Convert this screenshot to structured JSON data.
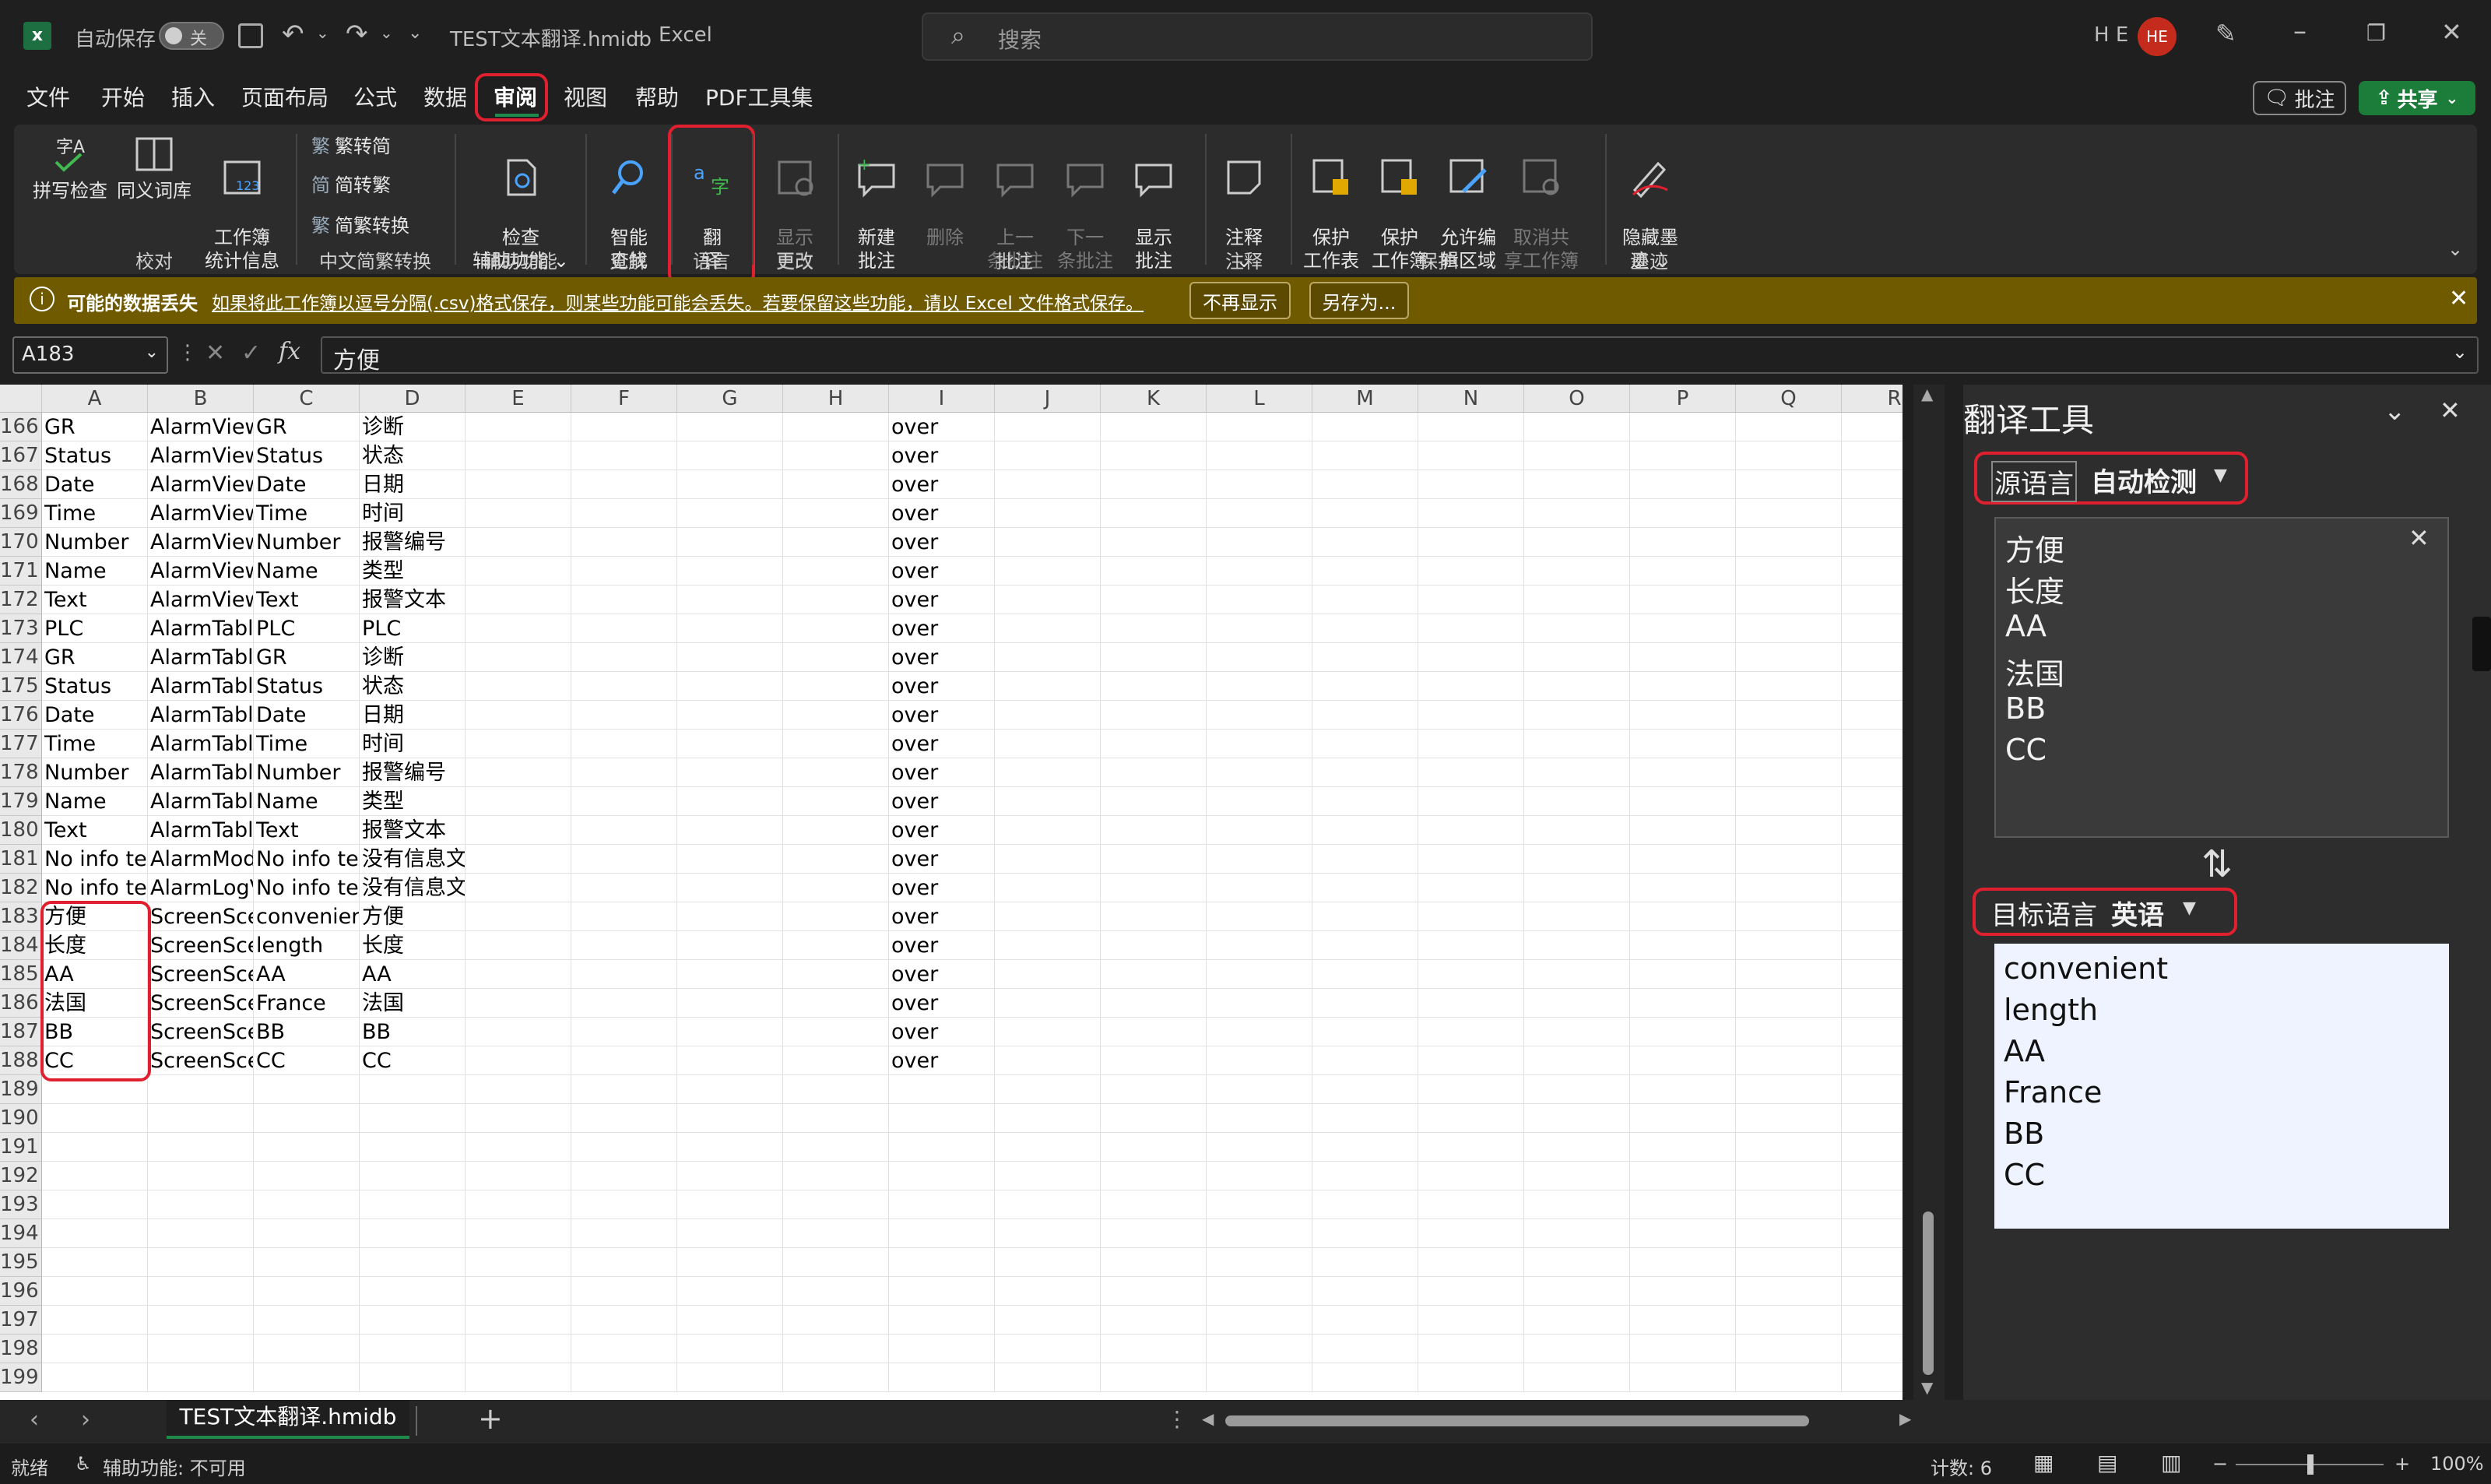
{
  "window": {
    "autosave_label": "自动保存",
    "autosave_state": "关",
    "file_title": "TEST文本翻译.hmidb",
    "app_separator": "-",
    "app_name": "Excel",
    "search_placeholder": "搜索",
    "user_initials": "H E",
    "avatar_text": "HE"
  },
  "menu": {
    "tabs": [
      "文件",
      "开始",
      "插入",
      "页面布局",
      "公式",
      "数据",
      "审阅",
      "视图",
      "帮助",
      "PDF工具集"
    ],
    "active_tab": "审阅",
    "comment_button": "批注",
    "share_button": "共享"
  },
  "ribbon": {
    "groups": {
      "proofing": {
        "label": "校对",
        "items": [
          "拼写检查",
          "同义词库",
          "工作簿\n统计信息"
        ]
      },
      "chinese": {
        "label": "中文简繁转换",
        "items": [
          "繁转简",
          "简转繁",
          "简繁转换"
        ]
      },
      "accessibility": {
        "label": "辅助功能",
        "items": [
          "检查\n辅助功能 ⌄"
        ]
      },
      "insights": {
        "label": "见解",
        "items": [
          "智能\n查找"
        ]
      },
      "language": {
        "label": "语言",
        "items": [
          "翻\n译"
        ]
      },
      "changes": {
        "label": "更改",
        "items": [
          "显示\n更改"
        ]
      },
      "comments": {
        "label": "批注",
        "items": [
          "新建\n批注",
          "删除",
          "上一\n条批注",
          "下一\n条批注",
          "显示\n批注"
        ]
      },
      "notes": {
        "label": "注释",
        "items": [
          "注释\n⌄"
        ]
      },
      "protect": {
        "label": "保护",
        "items": [
          "保护\n工作表",
          "保护\n工作簿",
          "允许编\n辑区域",
          "取消共\n享工作簿"
        ]
      },
      "ink": {
        "label": "墨迹",
        "items": [
          "隐藏墨\n迹 ⌄"
        ]
      }
    }
  },
  "notice": {
    "title": "可能的数据丢失",
    "message": "如果将此工作簿以逗号分隔(.csv)格式保存，则某些功能可能会丢失。若要保留这些功能，请以 Excel 文件格式保存。",
    "dont_show": "不再显示",
    "save_as": "另存为..."
  },
  "formula_bar": {
    "name_box": "A183",
    "fx": "fx",
    "value": "方便"
  },
  "columns": [
    "A",
    "B",
    "C",
    "D",
    "E",
    "F",
    "G",
    "H",
    "I",
    "J",
    "K",
    "L",
    "M",
    "N",
    "O",
    "P",
    "Q",
    "R"
  ],
  "rows": [
    {
      "n": "166",
      "a": "GR",
      "b": "AlarmView",
      "c": "GR",
      "d": "诊断",
      "i": "over"
    },
    {
      "n": "167",
      "a": "Status",
      "b": "AlarmView",
      "c": "Status",
      "d": "状态",
      "i": "over"
    },
    {
      "n": "168",
      "a": "Date",
      "b": "AlarmView",
      "c": "Date",
      "d": "日期",
      "i": "over"
    },
    {
      "n": "169",
      "a": "Time",
      "b": "AlarmView",
      "c": "Time",
      "d": "时间",
      "i": "over"
    },
    {
      "n": "170",
      "a": "Number",
      "b": "AlarmView",
      "c": "Number",
      "d": "报警编号",
      "i": "over"
    },
    {
      "n": "171",
      "a": "Name",
      "b": "AlarmView",
      "c": "Name",
      "d": "类型",
      "i": "over"
    },
    {
      "n": "172",
      "a": "Text",
      "b": "AlarmView",
      "c": "Text",
      "d": "报警文本",
      "i": "over"
    },
    {
      "n": "173",
      "a": "PLC",
      "b": "AlarmTabl",
      "c": "PLC",
      "d": "PLC",
      "i": "over"
    },
    {
      "n": "174",
      "a": "GR",
      "b": "AlarmTabl",
      "c": "GR",
      "d": "诊断",
      "i": "over"
    },
    {
      "n": "175",
      "a": "Status",
      "b": "AlarmTabl",
      "c": "Status",
      "d": "状态",
      "i": "over"
    },
    {
      "n": "176",
      "a": "Date",
      "b": "AlarmTabl",
      "c": "Date",
      "d": "日期",
      "i": "over"
    },
    {
      "n": "177",
      "a": "Time",
      "b": "AlarmTabl",
      "c": "Time",
      "d": "时间",
      "i": "over"
    },
    {
      "n": "178",
      "a": "Number",
      "b": "AlarmTabl",
      "c": "Number",
      "d": "报警编号",
      "i": "over"
    },
    {
      "n": "179",
      "a": "Name",
      "b": "AlarmTabl",
      "c": "Name",
      "d": "类型",
      "i": "over"
    },
    {
      "n": "180",
      "a": "Text",
      "b": "AlarmTabl",
      "c": "Text",
      "d": "报警文本",
      "i": "over"
    },
    {
      "n": "181",
      "a": "No info te",
      "b": "AlarmMod",
      "c": "No info te",
      "d": "没有信息文本.",
      "i": "over"
    },
    {
      "n": "182",
      "a": "No info te",
      "b": "AlarmLogV",
      "c": "No info te",
      "d": "没有信息文本.",
      "i": "over"
    },
    {
      "n": "183",
      "a": "方便",
      "b": "ScreenScei",
      "c": "convenien",
      "d": "方便",
      "i": "over"
    },
    {
      "n": "184",
      "a": "长度",
      "b": "ScreenScei",
      "c": "length",
      "d": "长度",
      "i": "over"
    },
    {
      "n": "185",
      "a": "AA",
      "b": "ScreenScei",
      "c": "AA",
      "d": "AA",
      "i": "over"
    },
    {
      "n": "186",
      "a": "法国",
      "b": "ScreenScei",
      "c": "France",
      "d": "法国",
      "i": "over"
    },
    {
      "n": "187",
      "a": "BB",
      "b": "ScreenScei",
      "c": "BB",
      "d": "BB",
      "i": "over"
    },
    {
      "n": "188",
      "a": "CC",
      "b": "ScreenScei",
      "c": "CC",
      "d": "CC",
      "i": "over"
    },
    {
      "n": "189"
    },
    {
      "n": "190"
    },
    {
      "n": "191"
    },
    {
      "n": "192"
    },
    {
      "n": "193"
    },
    {
      "n": "194"
    },
    {
      "n": "195"
    },
    {
      "n": "196"
    },
    {
      "n": "197"
    },
    {
      "n": "198"
    },
    {
      "n": "199"
    }
  ],
  "translate_pane": {
    "title": "翻译工具",
    "source_label": "源语言",
    "source_value": "自动检测",
    "source_lines": [
      "方便",
      "长度",
      "AA",
      "法国",
      "BB",
      "CC"
    ],
    "target_label": "目标语言",
    "target_value": "英语",
    "target_lines": [
      "convenient",
      "length",
      "AA",
      "France",
      "BB",
      "CC"
    ]
  },
  "sheet_tab": "TEST文本翻译.hmidb",
  "add_sheet": "+",
  "status": {
    "ready": "就绪",
    "accessibility": "辅助功能: 不可用",
    "count": "计数: 6",
    "zoom": "100%",
    "zoom_minus": "−",
    "zoom_plus": "+"
  }
}
